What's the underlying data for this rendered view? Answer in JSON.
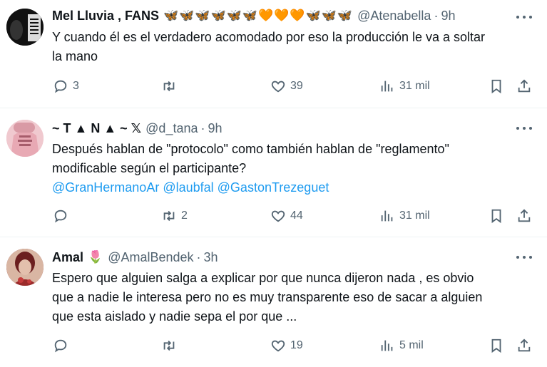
{
  "tweets": [
    {
      "name": "Mel Lluvia , FANS",
      "emojis": [
        "🦋",
        "🦋",
        "🦋",
        "🦋",
        "🦋",
        "🦋",
        "🧡",
        "🧡",
        "🧡",
        "🦋",
        "🦋",
        "🦋"
      ],
      "handle": "@Atenabella",
      "dot": "·",
      "time": "9h",
      "text_lines": [
        "Y cuando él es el verdadero acomodado por eso la producción le va a soltar",
        "la mano"
      ],
      "mentions": [],
      "replies": "3",
      "retweets": "",
      "likes": "39",
      "views": "31 mil"
    },
    {
      "name": "~ T ▲ N ▲ ~ 𝕏",
      "emojis": [],
      "handle": "@d_tana",
      "dot": "·",
      "time": "9h",
      "text_lines": [
        "Después hablan de \"protocolo\" como también hablan de \"reglamento\"",
        "modificable según el participante?"
      ],
      "mentions": [
        "@GranHermanoAr",
        "@laubfal",
        "@GastonTrezeguet"
      ],
      "replies": "",
      "retweets": "2",
      "likes": "44",
      "views": "31 mil"
    },
    {
      "name": "Amal",
      "emojis": [
        "🌷"
      ],
      "handle": "@AmalBendek",
      "dot": "·",
      "time": "3h",
      "text_lines": [
        "Espero que alguien salga a explicar por que nunca dijeron nada , es obvio",
        "que a nadie le interesa pero no es muy transparente eso de sacar a alguien",
        "que esta aislado y nadie sepa el por que ..."
      ],
      "mentions": [],
      "replies": "",
      "retweets": "",
      "likes": "19",
      "views": "5 mil"
    }
  ],
  "icons": {
    "reply": "reply-icon",
    "retweet": "retweet-icon",
    "like": "heart-icon",
    "views": "views-icon",
    "bookmark": "bookmark-icon",
    "share": "share-icon",
    "more": "more-icon"
  },
  "colors": {
    "text": "#0f1419",
    "secondary": "#536471",
    "link": "#1d9bf0",
    "divider": "#eff3f4"
  }
}
